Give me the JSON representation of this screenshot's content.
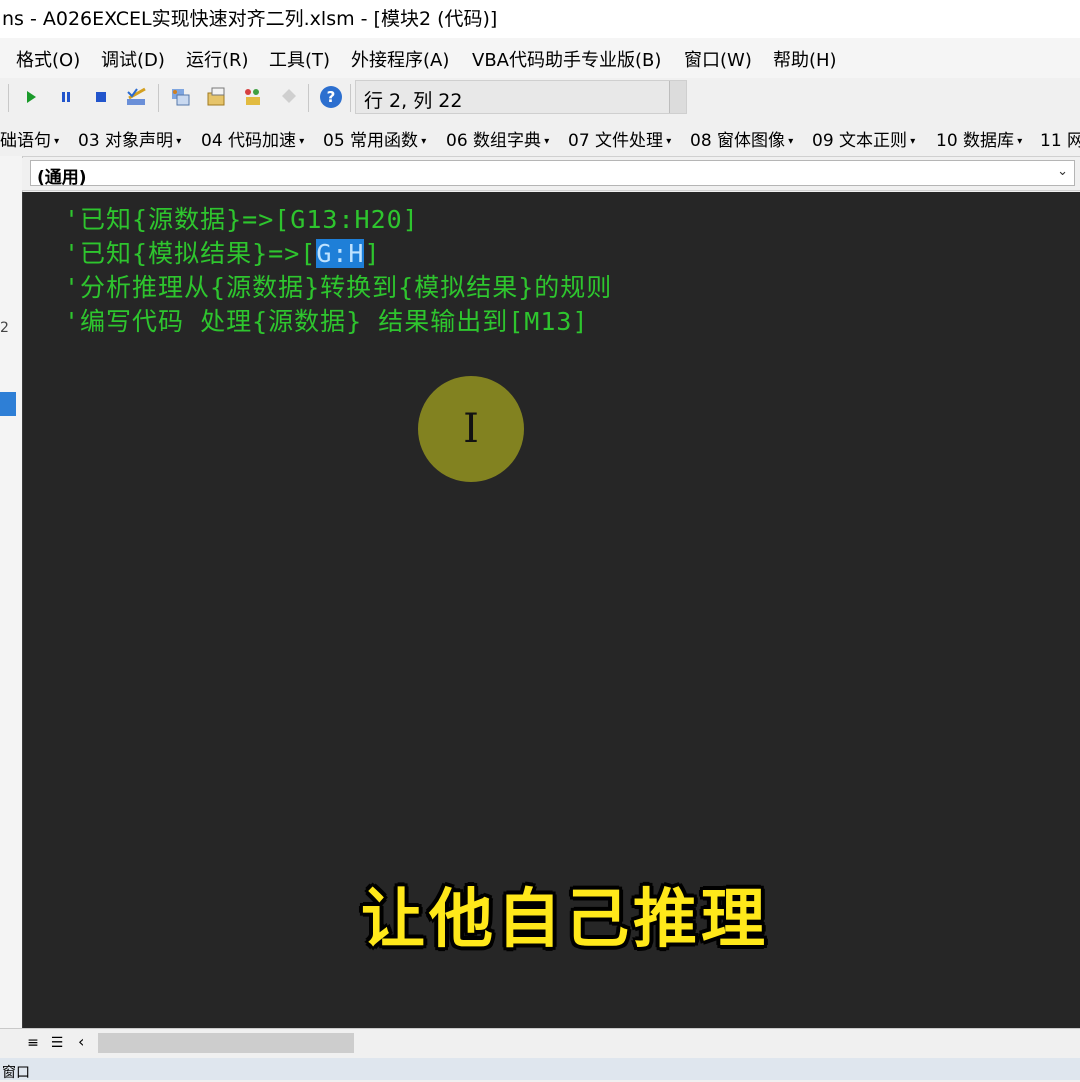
{
  "window": {
    "title": "ns - A026EXCEL实现快速对齐二列.xlsm - [模块2 (代码)]"
  },
  "menu": {
    "items": [
      "格式(O)",
      "调试(D)",
      "运行(R)",
      "工具(T)",
      "外接程序(A)",
      "VBA代码助手专业版(B)",
      "窗口(W)",
      "帮助(H)"
    ]
  },
  "toolbar": {
    "icons": [
      "run-icon",
      "pause-icon",
      "stop-icon",
      "design-mode-icon",
      "project-explorer-icon",
      "properties-icon",
      "object-browser-icon",
      "toolbox-icon",
      "help-icon"
    ],
    "position_text": "行 2, 列 22"
  },
  "addin_toolbar": {
    "items": [
      "础语句",
      "03 对象声明",
      "04 代码加速",
      "05 常用函数",
      "06 数组字典",
      "07 文件处理",
      "08 窗体图像",
      "09 文本正则",
      "10 数据库",
      "11 网"
    ]
  },
  "object_combo": {
    "value": "(通用)"
  },
  "left_strip": {
    "label": "2"
  },
  "code": {
    "lines": [
      {
        "text": "'已知{源数据}=>[G13:H20]"
      },
      {
        "prefix": "'已知{模拟结果}=>[",
        "selected": "G:H",
        "suffix": "]"
      },
      {
        "text": "'分析推理从{源数据}转换到{模拟结果}的规则"
      },
      {
        "text": "'编写代码 处理{源数据} 结果输出到[M13]"
      }
    ]
  },
  "subtitle": "让他自己推理",
  "statusbar": {
    "text": "窗口"
  },
  "colors": {
    "editor_background": "#262626",
    "comment_text": "#2ec52e",
    "selection": "#1e7fd8",
    "subtitle": "#ffe81a",
    "cursor_highlight": "#8a8a20"
  }
}
